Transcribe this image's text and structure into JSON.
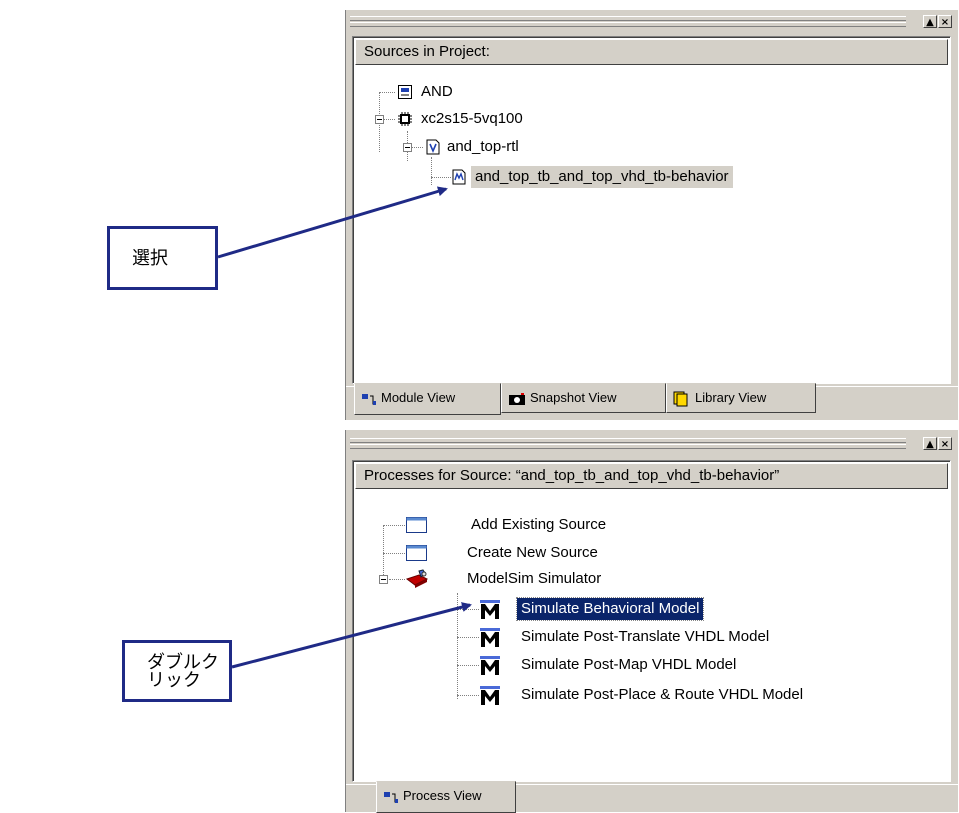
{
  "sources_panel": {
    "header": "Sources in Project:",
    "items": [
      {
        "label": "AND",
        "icon": "project-icon"
      },
      {
        "label": "xc2s15-5vq100",
        "icon": "chip-icon"
      },
      {
        "label": "and_top-rtl",
        "icon": "vhdl-file-icon"
      },
      {
        "label": "and_top_tb_and_top_vhd_tb-behavior",
        "icon": "testbench-icon"
      }
    ],
    "tabs": [
      {
        "label": "Module View",
        "icon": "module-view-icon"
      },
      {
        "label": "Snapshot View",
        "icon": "camera-icon"
      },
      {
        "label": "Library View",
        "icon": "library-icon"
      }
    ],
    "window_buttons": {
      "restore": "▲",
      "close": "×"
    }
  },
  "processes_panel": {
    "header": "Processes for Source: “and_top_tb_and_top_vhd_tb-behavior”",
    "items": [
      {
        "label": "Add Existing Source",
        "icon": "window-icon"
      },
      {
        "label": "Create New Source",
        "icon": "window-icon"
      },
      {
        "label": "ModelSim Simulator",
        "icon": "tools-icon"
      },
      {
        "label": "Simulate Behavioral Model",
        "icon": "modelsim-icon"
      },
      {
        "label": "Simulate Post-Translate VHDL Model",
        "icon": "modelsim-icon"
      },
      {
        "label": "Simulate Post-Map VHDL Model",
        "icon": "modelsim-icon"
      },
      {
        "label": "Simulate Post-Place & Route VHDL Model",
        "icon": "modelsim-icon"
      }
    ],
    "tabs": [
      {
        "label": "Process View",
        "icon": "process-view-icon"
      }
    ],
    "window_buttons": {
      "restore": "▲",
      "close": "×"
    }
  },
  "callouts": {
    "select": "選択",
    "double_click": "ダブルクリック"
  },
  "colors": {
    "callout_border": "#1f2a86",
    "selection_blue": "#0a246a",
    "panel_face": "#d4d0c8"
  }
}
